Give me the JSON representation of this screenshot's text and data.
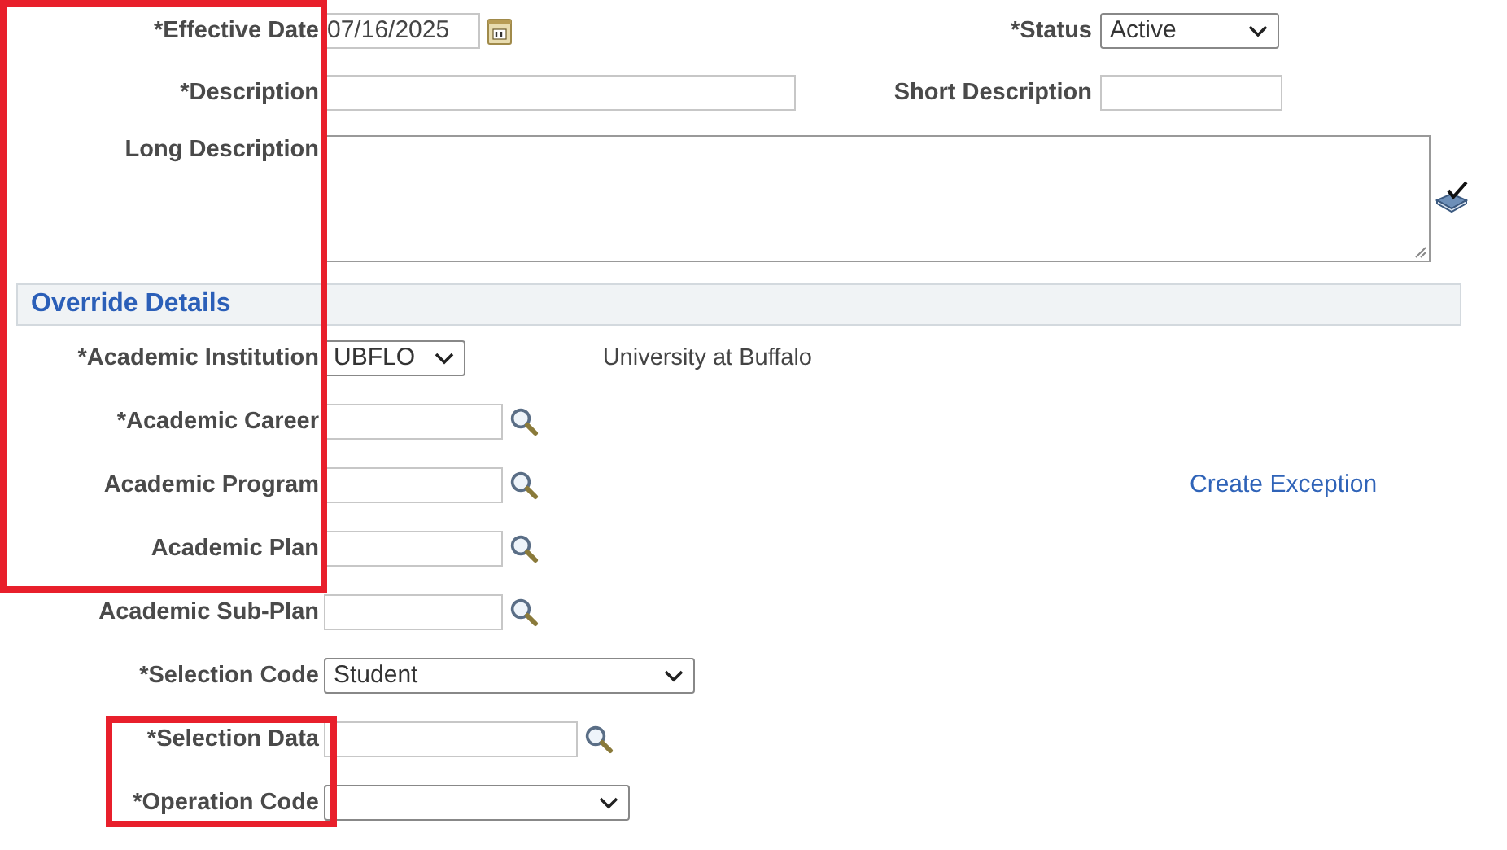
{
  "rows": [
    {
      "kind": "field",
      "label": "*Effective Date",
      "highlighted": true,
      "control": {
        "kind": "date",
        "value": "07/16/2025"
      },
      "aside": {
        "kind": "select",
        "label": "*Status",
        "value": "Active"
      }
    },
    {
      "kind": "field",
      "label": "*Description",
      "highlighted": true,
      "control": {
        "kind": "text"
      },
      "aside": {
        "kind": "text",
        "label": "Short Description"
      }
    },
    {
      "kind": "field",
      "label": "Long Description",
      "highlighted": true,
      "control": {
        "kind": "textarea"
      }
    },
    {
      "kind": "header",
      "label": "Override Details",
      "highlighted": true
    },
    {
      "kind": "field",
      "label": "*Academic Institution",
      "highlighted": true,
      "control": {
        "kind": "select",
        "value": "UBFLO"
      },
      "note": "University at Buffalo"
    },
    {
      "kind": "field",
      "label": "*Academic Career",
      "highlighted": true,
      "control": {
        "kind": "lookup"
      }
    },
    {
      "kind": "field",
      "label": "Academic Program",
      "highlighted": true,
      "control": {
        "kind": "lookup"
      },
      "aside": {
        "kind": "link",
        "label": "Create Exception"
      }
    },
    {
      "kind": "field",
      "label": "Academic Plan",
      "highlighted": true,
      "control": {
        "kind": "lookup"
      }
    },
    {
      "kind": "field",
      "label": "Academic Sub-Plan",
      "highlighted": false,
      "control": {
        "kind": "lookup"
      }
    },
    {
      "kind": "field",
      "label": "*Selection Code",
      "highlighted": false,
      "control": {
        "kind": "select",
        "value": "Student"
      }
    },
    {
      "kind": "field",
      "label": "*Selection Data",
      "highlighted": true,
      "control": {
        "kind": "lookup"
      }
    },
    {
      "kind": "field",
      "label": "*Operation Code",
      "highlighted": true,
      "control": {
        "kind": "select"
      }
    }
  ]
}
